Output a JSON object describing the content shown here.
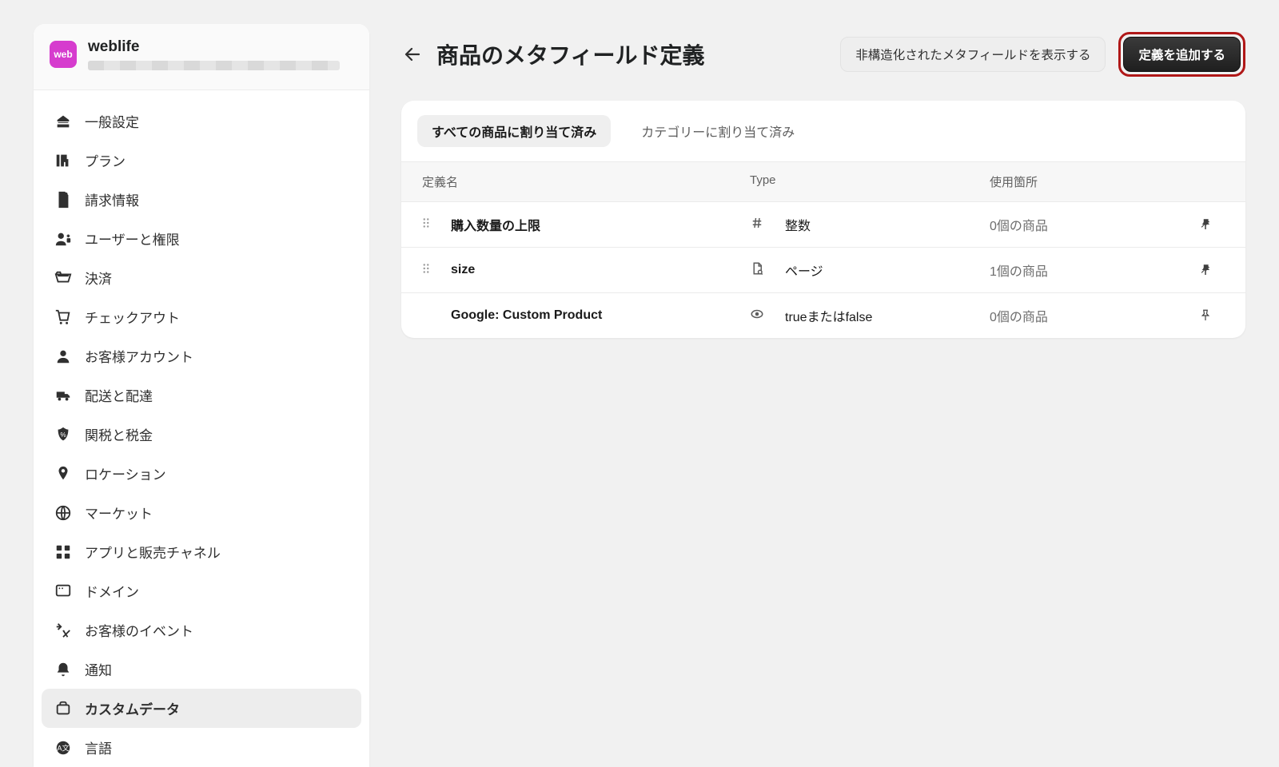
{
  "store": {
    "badge": "web",
    "name": "weblife"
  },
  "sidebar": {
    "items": [
      {
        "label": "一般設定"
      },
      {
        "label": "プラン"
      },
      {
        "label": "請求情報"
      },
      {
        "label": "ユーザーと権限"
      },
      {
        "label": "決済"
      },
      {
        "label": "チェックアウト"
      },
      {
        "label": "お客様アカウント"
      },
      {
        "label": "配送と配達"
      },
      {
        "label": "関税と税金"
      },
      {
        "label": "ロケーション"
      },
      {
        "label": "マーケット"
      },
      {
        "label": "アプリと販売チャネル"
      },
      {
        "label": "ドメイン"
      },
      {
        "label": "お客様のイベント"
      },
      {
        "label": "通知"
      },
      {
        "label": "カスタムデータ"
      },
      {
        "label": "言語"
      }
    ],
    "activeIndex": 15
  },
  "header": {
    "title": "商品のメタフィールド定義",
    "secondaryButton": "非構造化されたメタフィールドを表示する",
    "primaryButton": "定義を追加する"
  },
  "tabs": [
    {
      "label": "すべての商品に割り当て済み",
      "active": true
    },
    {
      "label": "カテゴリーに割り当て済み",
      "active": false
    }
  ],
  "table": {
    "columns": {
      "name": "定義名",
      "type": "Type",
      "usage": "使用箇所"
    },
    "rows": [
      {
        "name": "購入数量の上限",
        "typeIcon": "hash",
        "type": "整数",
        "usage": "0個の商品",
        "pinned": true,
        "draggable": true
      },
      {
        "name": "size",
        "typeIcon": "page",
        "type": "ページ",
        "usage": "1個の商品",
        "pinned": true,
        "draggable": true
      },
      {
        "name": "Google: Custom Product",
        "typeIcon": "eye",
        "type": "trueまたはfalse",
        "usage": "0個の商品",
        "pinned": false,
        "draggable": false
      }
    ]
  }
}
